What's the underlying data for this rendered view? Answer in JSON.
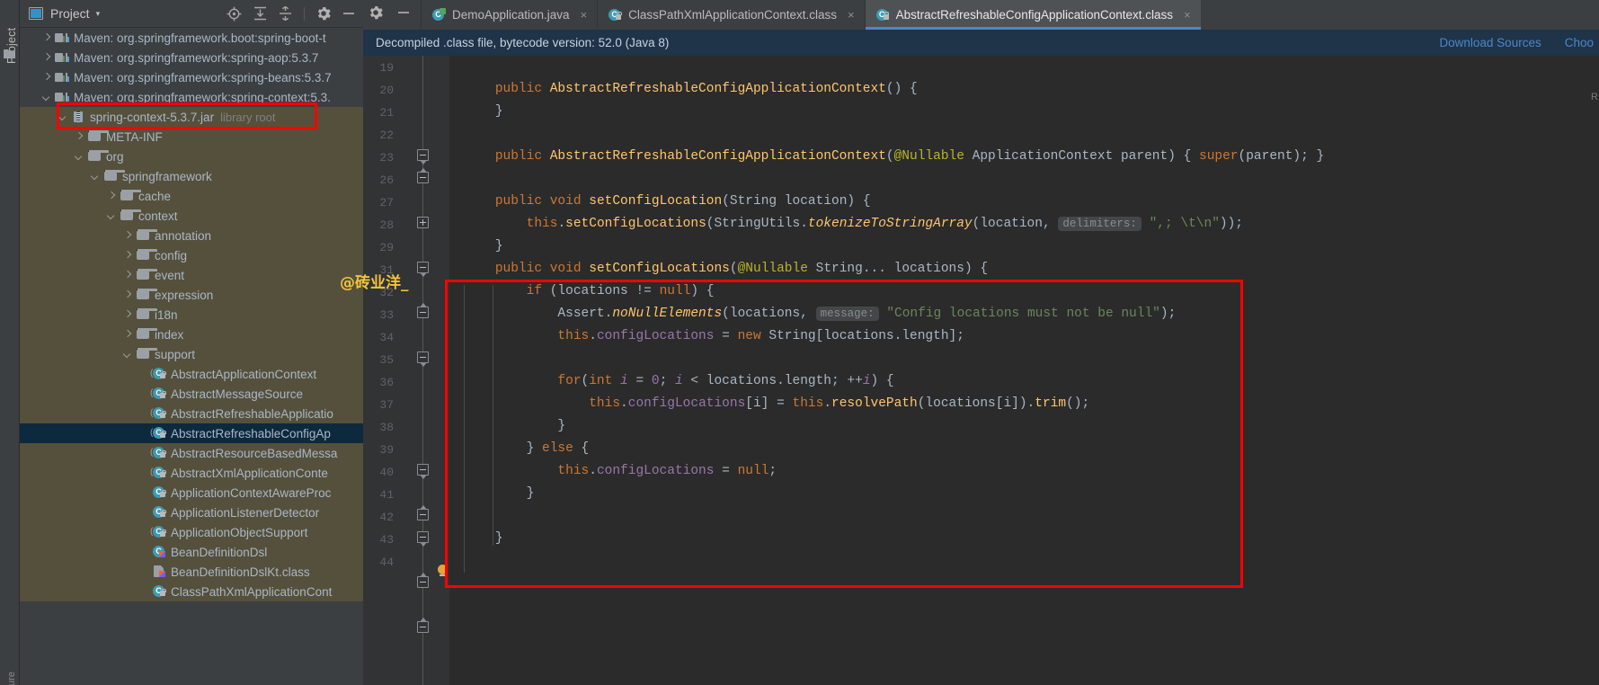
{
  "toolstrip": {
    "project_label": "Project",
    "structure_label": "ure",
    "folder_icon": "folder-icon"
  },
  "project_panel": {
    "title": "Project",
    "caret": "▾",
    "actions": [
      {
        "name": "locate-icon",
        "glyph": "locate"
      },
      {
        "name": "expand-all-icon",
        "glyph": "expand-all"
      },
      {
        "name": "collapse-all-icon",
        "glyph": "collapse-all"
      },
      {
        "name": "gear-icon",
        "glyph": "gear"
      },
      {
        "name": "hide-icon",
        "glyph": "minus"
      }
    ],
    "tree": [
      {
        "indent": 1,
        "arrow": "right",
        "icon": "maven",
        "label": "Maven: org.springframework.boot:spring-boot-t",
        "state": "normal"
      },
      {
        "indent": 1,
        "arrow": "right",
        "icon": "maven",
        "label": "Maven: org.springframework:spring-aop:5.3.7",
        "state": "normal"
      },
      {
        "indent": 1,
        "arrow": "right",
        "icon": "maven",
        "label": "Maven: org.springframework:spring-beans:5.3.7",
        "state": "normal"
      },
      {
        "indent": 1,
        "arrow": "down",
        "icon": "maven",
        "label": "Maven: org.springframework:spring-context:5.3.",
        "state": "normal"
      },
      {
        "indent": 2,
        "arrow": "down",
        "icon": "jar",
        "label": "spring-context-5.3.7.jar",
        "note": "library root",
        "state": "olive"
      },
      {
        "indent": 3,
        "arrow": "right",
        "icon": "folder",
        "label": "META-INF",
        "state": "olive"
      },
      {
        "indent": 3,
        "arrow": "down",
        "icon": "folder",
        "label": "org",
        "state": "olive"
      },
      {
        "indent": 4,
        "arrow": "down",
        "icon": "folder",
        "label": "springframework",
        "state": "olive"
      },
      {
        "indent": 5,
        "arrow": "right",
        "icon": "folder",
        "label": "cache",
        "state": "olive"
      },
      {
        "indent": 5,
        "arrow": "down",
        "icon": "folder",
        "label": "context",
        "state": "olive"
      },
      {
        "indent": 6,
        "arrow": "right",
        "icon": "folder",
        "label": "annotation",
        "state": "olive"
      },
      {
        "indent": 6,
        "arrow": "right",
        "icon": "folder",
        "label": "config",
        "state": "olive"
      },
      {
        "indent": 6,
        "arrow": "right",
        "icon": "folder",
        "label": "event",
        "state": "olive"
      },
      {
        "indent": 6,
        "arrow": "right",
        "icon": "folder",
        "label": "expression",
        "state": "olive"
      },
      {
        "indent": 6,
        "arrow": "right",
        "icon": "folder",
        "label": "i18n",
        "state": "olive"
      },
      {
        "indent": 6,
        "arrow": "right",
        "icon": "folder",
        "label": "index",
        "state": "olive"
      },
      {
        "indent": 6,
        "arrow": "down",
        "icon": "folder",
        "label": "support",
        "state": "olive"
      },
      {
        "indent": 7,
        "arrow": "none",
        "icon": "abstract-class",
        "label": "AbstractApplicationContext",
        "state": "olive"
      },
      {
        "indent": 7,
        "arrow": "none",
        "icon": "abstract-class",
        "label": "AbstractMessageSource",
        "state": "olive"
      },
      {
        "indent": 7,
        "arrow": "none",
        "icon": "abstract-class",
        "label": "AbstractRefreshableApplicatio",
        "state": "olive"
      },
      {
        "indent": 7,
        "arrow": "none",
        "icon": "abstract-class",
        "label": "AbstractRefreshableConfigAp",
        "state": "selected"
      },
      {
        "indent": 7,
        "arrow": "none",
        "icon": "abstract-class",
        "label": "AbstractResourceBasedMessa",
        "state": "olive"
      },
      {
        "indent": 7,
        "arrow": "none",
        "icon": "abstract-class",
        "label": "AbstractXmlApplicationConte",
        "state": "olive"
      },
      {
        "indent": 7,
        "arrow": "none",
        "icon": "class",
        "label": "ApplicationContextAwareProc",
        "state": "olive"
      },
      {
        "indent": 7,
        "arrow": "none",
        "icon": "class",
        "label": "ApplicationListenerDetector",
        "state": "olive"
      },
      {
        "indent": 7,
        "arrow": "none",
        "icon": "abstract-class",
        "label": "ApplicationObjectSupport",
        "state": "olive"
      },
      {
        "indent": 7,
        "arrow": "none",
        "icon": "kotlin-class",
        "label": "BeanDefinitionDsl",
        "state": "olive"
      },
      {
        "indent": 7,
        "arrow": "none",
        "icon": "kotlin-file",
        "label": "BeanDefinitionDslKt.class",
        "state": "olive"
      },
      {
        "indent": 7,
        "arrow": "none",
        "icon": "class",
        "label": "ClassPathXmlApplicationCont",
        "state": "olive"
      }
    ]
  },
  "editor": {
    "tabs": [
      {
        "label": "DemoApplication.java",
        "icon": "java-class-icon",
        "active": false,
        "close": "×"
      },
      {
        "label": "ClassPathXmlApplicationContext.class",
        "icon": "class-icon",
        "active": false,
        "close": "×"
      },
      {
        "label": "AbstractRefreshableConfigApplicationContext.class",
        "icon": "class-icon",
        "active": true,
        "close": "×"
      }
    ],
    "notification": {
      "message": "Decompiled .class file, bytecode version: 52.0 (Java 8)",
      "download_sources": "Download Sources",
      "choose_sources": "Choo"
    },
    "right_edge_text": "R",
    "line_numbers": [
      "19",
      "20",
      "21",
      "22",
      "23",
      "26",
      "27",
      "28",
      "29",
      "31",
      "32",
      "33",
      "34",
      "35",
      "36",
      "37",
      "38",
      "39",
      "40",
      "41",
      "42",
      "43",
      "44"
    ],
    "code_lines": [
      {
        "num": "19",
        "text": ""
      },
      {
        "num": "20",
        "text": "public AbstractRefreshableConfigApplicationContext() {"
      },
      {
        "num": "21",
        "text": "}"
      },
      {
        "num": "22",
        "text": ""
      },
      {
        "num": "23",
        "text": "public AbstractRefreshableConfigApplicationContext(@Nullable ApplicationContext parent) { super(parent); }"
      },
      {
        "num": "26",
        "text": ""
      },
      {
        "num": "27",
        "text": "public void setConfigLocation(String location) {"
      },
      {
        "num": "28",
        "text": "this.setConfigLocations(StringUtils.tokenizeToStringArray(location, delimiters: \",; \\t\\n\"));"
      },
      {
        "num": "29",
        "text": "}"
      },
      {
        "num": "31",
        "text": "public void setConfigLocations(@Nullable String... locations) {"
      },
      {
        "num": "32",
        "text": "if (locations != null) {"
      },
      {
        "num": "33",
        "text": "Assert.noNullElements(locations, message: \"Config locations must not be null\");"
      },
      {
        "num": "34",
        "text": "this.configLocations = new String[locations.length];"
      },
      {
        "num": "35",
        "text": ""
      },
      {
        "num": "36",
        "text": "for(int i = 0; i < locations.length; ++i) {"
      },
      {
        "num": "37",
        "text": "this.configLocations[i] = this.resolvePath(locations[i]).trim();"
      },
      {
        "num": "38",
        "text": "}"
      },
      {
        "num": "39",
        "text": "} else {"
      },
      {
        "num": "40",
        "text": "this.configLocations = null;"
      },
      {
        "num": "41",
        "text": "}"
      },
      {
        "num": "42",
        "text": ""
      },
      {
        "num": "43",
        "text": "}"
      },
      {
        "num": "44",
        "text": ""
      }
    ],
    "hints": {
      "delimiters": "delimiters:",
      "message": "message:"
    },
    "watermark": "@砖业洋_"
  },
  "colors": {
    "accent_blue": "#4a88c7",
    "keyword_orange": "#cc7832",
    "method_yellow": "#ffc66d",
    "string_green": "#6a8759",
    "annotation_yellow": "#bbb529",
    "field_purple": "#9876aa",
    "annotation_red": "#fe0000",
    "watermark_yellow": "#f3c33a",
    "selection_navy": "#0d293e",
    "olive_highlight": "#55503c"
  }
}
